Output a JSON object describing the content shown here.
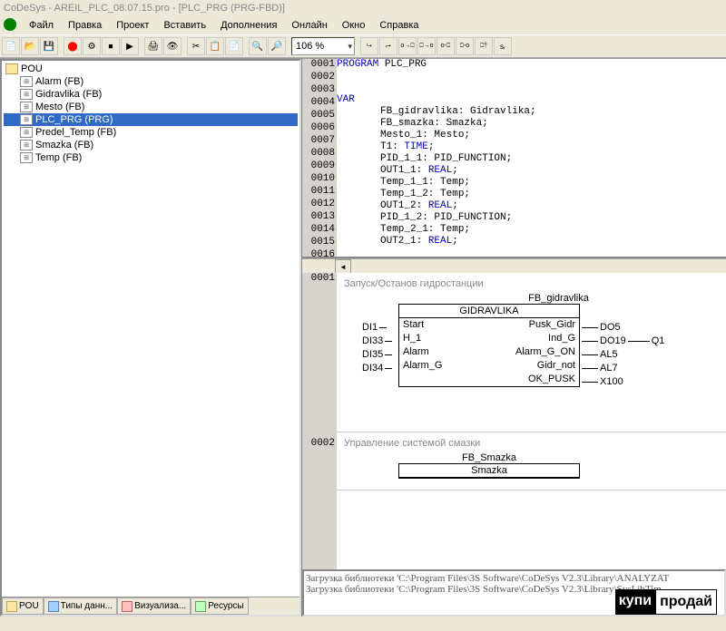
{
  "title": "CoDeSys - AREIL_PLC_08.07.15.pro - [PLC_PRG (PRG-FBD)]",
  "menu": [
    "Файл",
    "Правка",
    "Проект",
    "Вставить",
    "Дополнения",
    "Онлайн",
    "Окно",
    "Справка"
  ],
  "zoom": "106 %",
  "tree_root": "POU",
  "tree": [
    {
      "label": "Alarm (FB)"
    },
    {
      "label": "Gidravlika (FB)"
    },
    {
      "label": "Mesto (FB)"
    },
    {
      "label": "PLC_PRG (PRG)",
      "selected": true
    },
    {
      "label": "Predel_Temp (FB)"
    },
    {
      "label": "Smazka (FB)"
    },
    {
      "label": "Temp (FB)"
    }
  ],
  "bottom_tabs": [
    "POU",
    "Типы данн...",
    "Визуализа...",
    "Ресурсы"
  ],
  "code": {
    "lines": [
      {
        "n": "0001",
        "pre": "PROGRAM",
        "txt": " PLC_PRG"
      },
      {
        "n": "0002",
        "txt": ""
      },
      {
        "n": "0003",
        "txt": ""
      },
      {
        "n": "0004",
        "pre": "VAR",
        "txt": ""
      },
      {
        "n": "0005",
        "ind": "FB_gidravlika: Gidravlika;"
      },
      {
        "n": "0006",
        "ind": "FB_smazka: Smazka;"
      },
      {
        "n": "0007",
        "ind": "Mesto_1: Mesto;"
      },
      {
        "n": "0008",
        "ind": "T1: ",
        "type": "TIME",
        "post": ";"
      },
      {
        "n": "0009",
        "ind": "PID_1_1: PID_FUNCTION;"
      },
      {
        "n": "0010",
        "ind": "OUT1_1: ",
        "type": "REAL",
        "post": ";"
      },
      {
        "n": "0011",
        "ind": "Temp_1_1: Temp;"
      },
      {
        "n": "0012",
        "ind": "Temp_1_2: Temp;"
      },
      {
        "n": "0013",
        "ind": "OUT1_2: ",
        "type": "REAL",
        "post": ";"
      },
      {
        "n": "0014",
        "ind": "PID_1_2: PID_FUNCTION;"
      },
      {
        "n": "0015",
        "ind": "Temp_2_1: Temp;"
      },
      {
        "n": "0016",
        "ind": "OUT2_1: ",
        "type": "REAL",
        "post": ";"
      }
    ]
  },
  "fbd": {
    "net1": {
      "num": "0001",
      "title": "Запуск/Останов гидростанции",
      "instance": "FB_gidravlika",
      "type": "GIDRAVLIKA",
      "rows": [
        {
          "in": "DI1",
          "il": "Start",
          "ol": "Pusk_Gidr",
          "out": "DO5"
        },
        {
          "in": "DI33",
          "il": "H_1",
          "ol": "Ind_G",
          "out": "DO19",
          "ext": "Q1"
        },
        {
          "in": "DI35",
          "il": "Alarm",
          "ol": "Alarm_G_ON",
          "out": "AL5"
        },
        {
          "in": "DI34",
          "il": "Alarm_G",
          "ol": "Gidr_not",
          "out": "AL7"
        },
        {
          "in": "",
          "il": "",
          "ol": "OK_PUSK",
          "out": "X100"
        }
      ]
    },
    "net2": {
      "num": "0002",
      "title": "Управление системой смазки",
      "instance": "FB_Smazka",
      "type": "Smazka"
    }
  },
  "messages": [
    "Загрузка библиотеки 'C:\\Program Files\\3S Software\\CoDeSys V2.3\\Library\\ANALYZAT",
    "Загрузка библиотеки 'C:\\Program Files\\3S Software\\CoDeSys V2.3\\Library\\SysLibTim"
  ],
  "watermark": {
    "a": "купи",
    "b": "продай"
  }
}
